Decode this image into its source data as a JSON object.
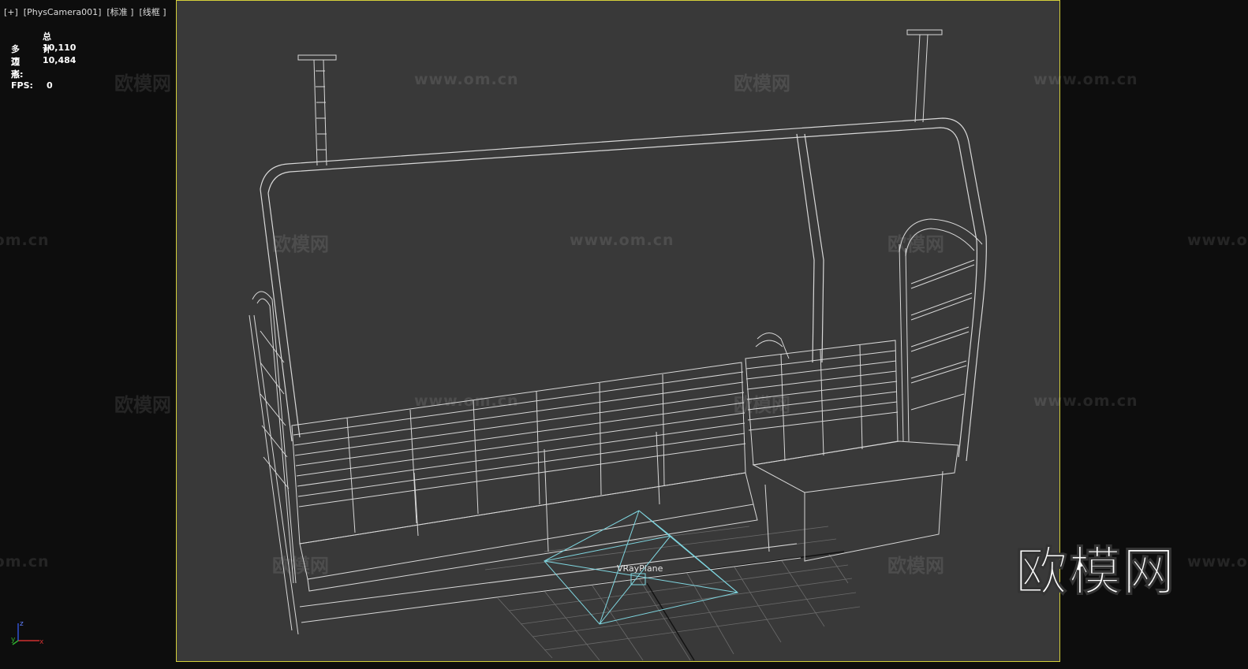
{
  "viewport": {
    "label": "[+]  [PhysCamera001]  [标准 ]  [线框 ]",
    "stats": {
      "header": "总计",
      "polygons_label": "多边形:",
      "polygons_value": "10,110",
      "vertices_label": "顶点:",
      "vertices_value": "10,484",
      "fps_label": "FPS:",
      "fps_value": "0"
    },
    "objects": {
      "vray_plane_label": "VRayPlane"
    },
    "axis": {
      "x": "x",
      "y": "y",
      "z": "z"
    }
  },
  "watermarks": {
    "cn": "欧模网",
    "url": "www.om.cn",
    "brand": "欧模网"
  },
  "colors": {
    "frame_border": "#d4cf3a",
    "viewport_bg": "#393939",
    "wire": "#d8d8d8",
    "vray_plane": "#7fd6e0"
  }
}
